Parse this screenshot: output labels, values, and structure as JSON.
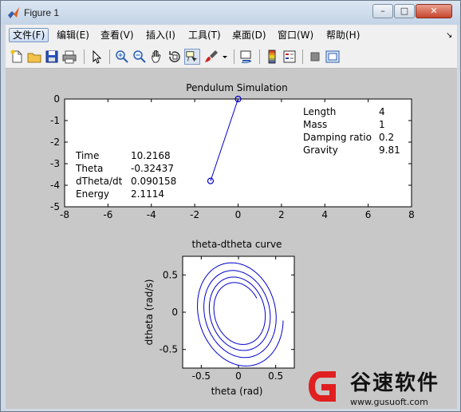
{
  "window": {
    "title": "Figure 1"
  },
  "titlebar_buttons": {
    "minimize": "–",
    "maximize": "□",
    "close": "✕"
  },
  "menu": [
    {
      "label": "文件(F)",
      "active": true
    },
    {
      "label": "编辑(E)"
    },
    {
      "label": "查看(V)"
    },
    {
      "label": "插入(I)"
    },
    {
      "label": "工具(T)"
    },
    {
      "label": "桌面(D)"
    },
    {
      "label": "窗口(W)"
    },
    {
      "label": "帮助(H)"
    }
  ],
  "menu_overflow": "↘",
  "toolbar": [
    "new-figure-icon",
    "open-icon",
    "save-icon",
    "print-icon",
    "pointer-icon",
    "zoom-in-icon",
    "zoom-out-icon",
    "pan-icon",
    "rotate-3d-icon",
    "data-cursor-icon",
    "brush-icon",
    "link-plot-icon",
    "colorbar-icon",
    "legend-icon",
    "hide-plot-tools-icon",
    "show-plot-tools-icon"
  ],
  "chart_data": [
    {
      "type": "line",
      "title": "Pendulum Simulation",
      "xlim": [
        -8,
        8
      ],
      "ylim": [
        -5,
        0
      ],
      "xticks": [
        "-8",
        "-6",
        "-4",
        "-2",
        "0",
        "2",
        "4",
        "6",
        "8"
      ],
      "yticks": [
        "0",
        "-1",
        "-2",
        "-3",
        "-4",
        "-5"
      ],
      "series": [
        {
          "x": [
            0,
            -1.27
          ],
          "y": [
            0,
            -3.8
          ],
          "marker": "circle",
          "color": "#0000cc"
        }
      ],
      "info_left": [
        {
          "label": "Time",
          "value": "10.2168"
        },
        {
          "label": "Theta",
          "value": "-0.32437"
        },
        {
          "label": "dTheta/dt",
          "value": "0.090158"
        },
        {
          "label": "Energy",
          "value": "2.1114"
        }
      ],
      "info_right": [
        {
          "label": "Length",
          "value": "4"
        },
        {
          "label": "Mass",
          "value": "1"
        },
        {
          "label": "Damping ratio",
          "value": "0.2"
        },
        {
          "label": "Gravity",
          "value": "9.81"
        }
      ]
    },
    {
      "type": "line",
      "title": "theta-dtheta curve",
      "xlabel": "theta (rad)",
      "ylabel": "dtheta (rad/s)",
      "xlim": [
        -0.75,
        0.75
      ],
      "ylim": [
        -0.75,
        0.75
      ],
      "xticks": [
        "-0.5",
        "0",
        "0.5"
      ],
      "yticks": [
        "0.5",
        "0",
        "-0.5"
      ],
      "series": [
        {
          "color": "#0000cc"
        }
      ]
    }
  ],
  "watermark": {
    "brand": "谷速软件",
    "url": "www.gusuoft.com"
  }
}
